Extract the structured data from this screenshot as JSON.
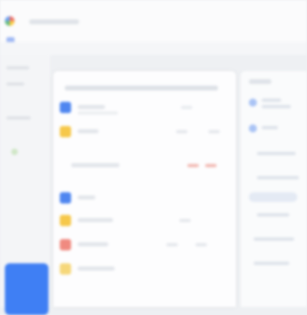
{
  "colors": {
    "accent": "#3f7ff4",
    "warning": "#f6c84a",
    "danger": "#ef6a5e",
    "success": "#7bc67a"
  },
  "icons": [
    "app-logo-icon",
    "menu-icon",
    "doc-icon",
    "folder-icon",
    "star-icon",
    "people-icon",
    "compose-icon"
  ],
  "main": {
    "rows": [
      {
        "icon": "doc-icon",
        "color": "#4f86f0"
      },
      {
        "icon": "folder-icon",
        "color": "#f6c84a"
      },
      {
        "icon": "file-icon",
        "color": "#e9edf2"
      },
      {
        "icon": "doc-icon",
        "color": "#4f86f0"
      },
      {
        "icon": "folder-icon",
        "color": "#f6c84a"
      },
      {
        "icon": "file-icon",
        "color": "#f08a80"
      },
      {
        "icon": "file-icon",
        "color": "#f6d77a"
      }
    ]
  },
  "right": {
    "items": [
      "person-icon",
      "person-icon",
      "link-icon",
      "link-icon"
    ]
  }
}
